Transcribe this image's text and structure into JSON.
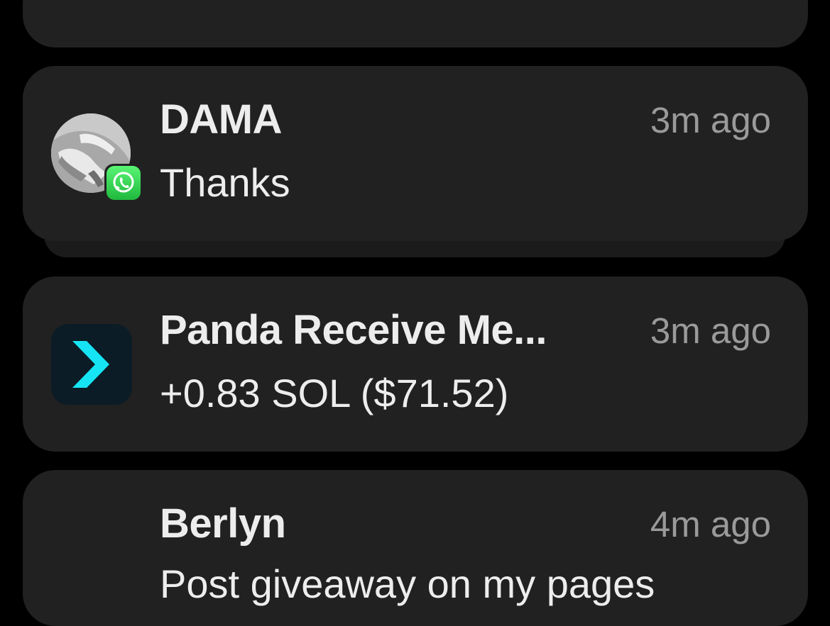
{
  "notifications": [
    {
      "title": "DAMA",
      "time": "3m ago",
      "message": "Thanks",
      "avatar_icon": "contact-photo",
      "badge_icon": "whatsapp-icon"
    },
    {
      "title": "Panda Receive Me...",
      "time": "3m ago",
      "message": "+0.83 SOL ($71.52)",
      "app_icon": "chevron-right-app-icon"
    },
    {
      "title": "Berlyn",
      "time": "4m ago",
      "message": "Post giveaway on my pages"
    }
  ],
  "colors": {
    "background": "#000000",
    "card": "#212121",
    "title_text": "#ededed",
    "time_text": "#9a9a9a",
    "whatsapp_green": "#25d366",
    "app_accent": "#16e4f5"
  }
}
